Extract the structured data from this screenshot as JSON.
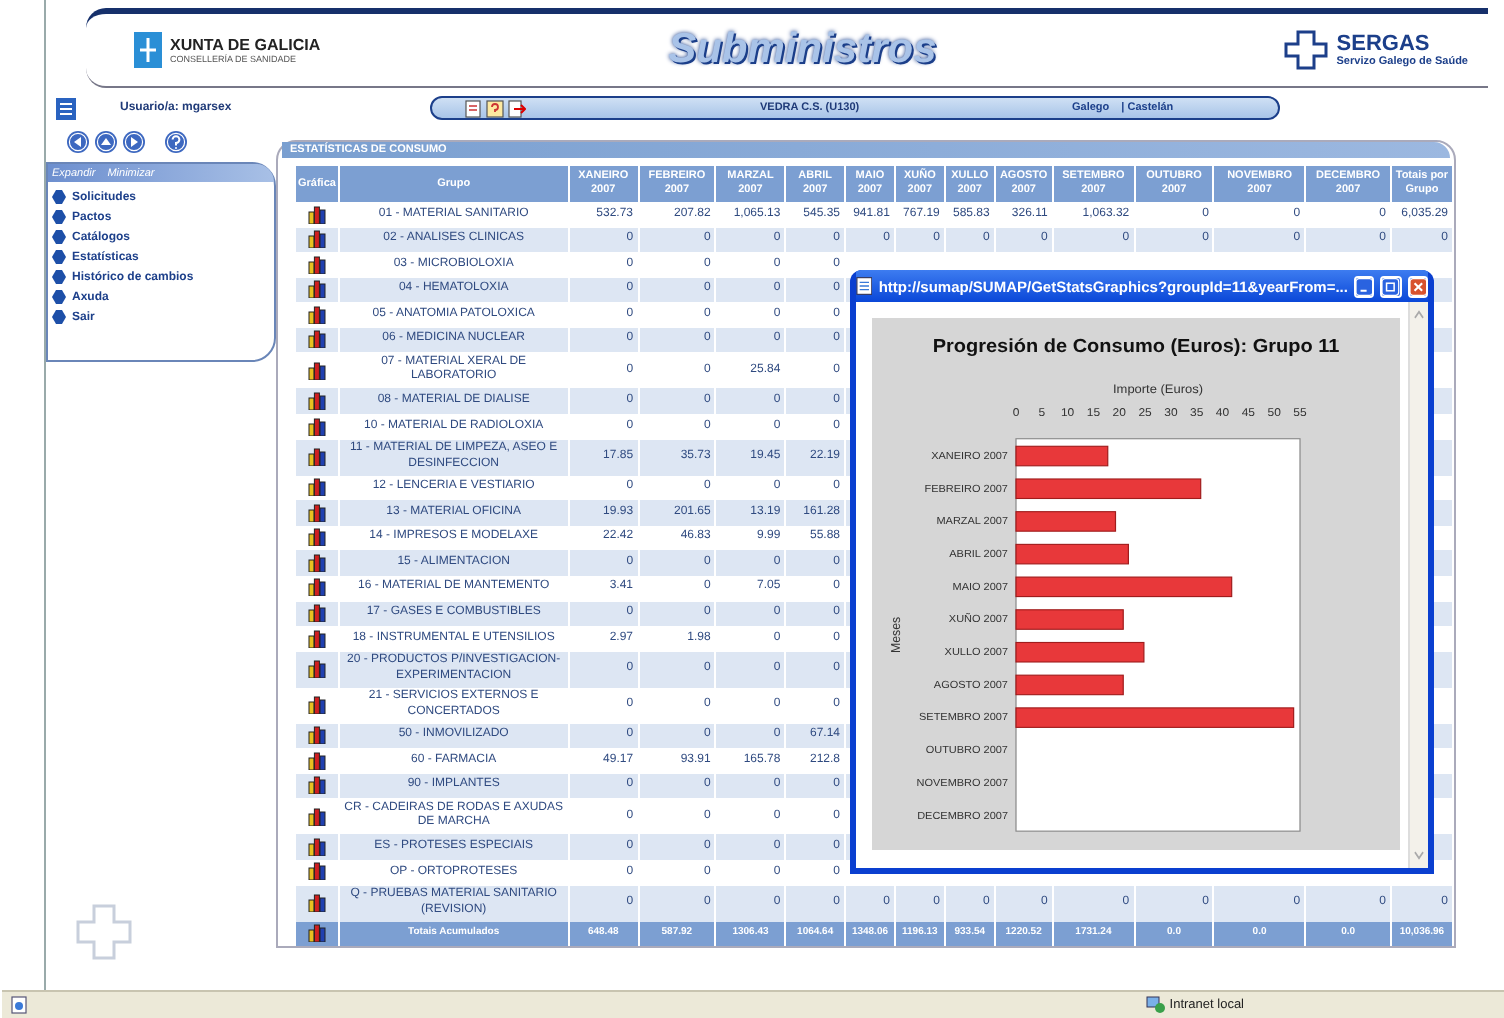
{
  "header": {
    "org": "XUNTA DE GALICIA",
    "org_sub": "CONSELLERÍA DE SANIDADE",
    "app_title": "Subministros",
    "brand": "SERGAS",
    "brand_sub": "Servizo Galego de Saúde"
  },
  "user_bar": {
    "user": "Usuario/a: mgarsex",
    "centre": "VEDRA C.S. (U130)",
    "languages": [
      "Galego",
      "| Castelán"
    ]
  },
  "sidebar": {
    "actions": [
      "Expandir",
      "Minimizar"
    ],
    "items": [
      "Solicitudes",
      "Pactos",
      "Catálogos",
      "Estatísticas",
      "Histórico de cambios",
      "Axuda",
      "Sair"
    ]
  },
  "section_title": "ESTATÍSTICAS DE CONSUMO",
  "table": {
    "columns": [
      {
        "label": "Gráfica"
      },
      {
        "label": "Grupo"
      },
      {
        "label": "XANEIRO",
        "sub": "2007"
      },
      {
        "label": "FEBREIRO",
        "sub": "2007"
      },
      {
        "label": "MARZAL",
        "sub": "2007"
      },
      {
        "label": "ABRIL",
        "sub": "2007"
      },
      {
        "label": "MAIO",
        "sub": "2007"
      },
      {
        "label": "XUÑO",
        "sub": "2007"
      },
      {
        "label": "XULLO",
        "sub": "2007"
      },
      {
        "label": "AGOSTO",
        "sub": "2007"
      },
      {
        "label": "SETEMBRO",
        "sub": "2007"
      },
      {
        "label": "OUTUBRO",
        "sub": "2007"
      },
      {
        "label": "NOVEMBRO",
        "sub": "2007"
      },
      {
        "label": "DECEMBRO",
        "sub": "2007"
      },
      {
        "label": "Totais por",
        "sub": "Grupo"
      }
    ],
    "rows": [
      {
        "group": "01 - MATERIAL SANITARIO",
        "values": [
          "532.73",
          "207.82",
          "1,065.13",
          "545.35",
          "941.81",
          "767.19",
          "585.83",
          "326.11",
          "1,063.32",
          "0",
          "0",
          "0",
          "6,035.29"
        ]
      },
      {
        "group": "02 - ANALISES CLINICAS",
        "values": [
          "0",
          "0",
          "0",
          "0",
          "0",
          "0",
          "0",
          "0",
          "0",
          "0",
          "0",
          "0",
          "0"
        ]
      },
      {
        "group": "03 - MICROBIOLOXIA",
        "values": [
          "0",
          "0",
          "0",
          "0"
        ]
      },
      {
        "group": "04 - HEMATOLOXIA",
        "values": [
          "0",
          "0",
          "0",
          "0"
        ]
      },
      {
        "group": "05 - ANATOMIA PATOLOXICA",
        "values": [
          "0",
          "0",
          "0",
          "0"
        ]
      },
      {
        "group": "06 - MEDICINA NUCLEAR",
        "values": [
          "0",
          "0",
          "0",
          "0"
        ]
      },
      {
        "group": "07 - MATERIAL XERAL DE LABORATORIO",
        "values": [
          "0",
          "0",
          "25.84",
          "0"
        ]
      },
      {
        "group": "08 - MATERIAL DE DIALISE",
        "values": [
          "0",
          "0",
          "0",
          "0"
        ]
      },
      {
        "group": "10 - MATERIAL DE RADIOLOXIA",
        "values": [
          "0",
          "0",
          "0",
          "0"
        ]
      },
      {
        "group": "11 - MATERIAL DE LIMPEZA, ASEO E DESINFECCION",
        "values": [
          "17.85",
          "35.73",
          "19.45",
          "22.19"
        ]
      },
      {
        "group": "12 - LENCERIA E VESTIARIO",
        "values": [
          "0",
          "0",
          "0",
          "0"
        ]
      },
      {
        "group": "13 - MATERIAL OFICINA",
        "values": [
          "19.93",
          "201.65",
          "13.19",
          "161.28"
        ]
      },
      {
        "group": "14 - IMPRESOS E MODELAXE",
        "values": [
          "22.42",
          "46.83",
          "9.99",
          "55.88"
        ]
      },
      {
        "group": "15 - ALIMENTACION",
        "values": [
          "0",
          "0",
          "0",
          "0"
        ]
      },
      {
        "group": "16 - MATERIAL DE MANTEMENTO",
        "values": [
          "3.41",
          "0",
          "7.05",
          "0"
        ]
      },
      {
        "group": "17 - GASES E COMBUSTIBLES",
        "values": [
          "0",
          "0",
          "0",
          "0"
        ]
      },
      {
        "group": "18 - INSTRUMENTAL E UTENSILIOS",
        "values": [
          "2.97",
          "1.98",
          "0",
          "0"
        ]
      },
      {
        "group": "20 - PRODUCTOS P/INVESTIGACION-EXPERIMENTACION",
        "values": [
          "0",
          "0",
          "0",
          "0"
        ]
      },
      {
        "group": "21 - SERVICIOS EXTERNOS E CONCERTADOS",
        "values": [
          "0",
          "0",
          "0",
          "0"
        ]
      },
      {
        "group": "50 - INMOVILIZADO",
        "values": [
          "0",
          "0",
          "0",
          "67.14"
        ]
      },
      {
        "group": "60 - FARMACIA",
        "values": [
          "49.17",
          "93.91",
          "165.78",
          "212.8"
        ]
      },
      {
        "group": "90 - IMPLANTES",
        "values": [
          "0",
          "0",
          "0",
          "0"
        ]
      },
      {
        "group": "CR - CADEIRAS DE RODAS E AXUDAS DE MARCHA",
        "values": [
          "0",
          "0",
          "0",
          "0"
        ]
      },
      {
        "group": "ES - PROTESES ESPECIAIS",
        "values": [
          "0",
          "0",
          "0",
          "0"
        ]
      },
      {
        "group": "OP - ORTOPROTESES",
        "values": [
          "0",
          "0",
          "0",
          "0"
        ]
      },
      {
        "group": "Q - PRUEBAS MATERIAL SANITARIO (REVISION)",
        "values": [
          "0",
          "0",
          "0",
          "0",
          "0",
          "0",
          "0",
          "0",
          "0",
          "0",
          "0",
          "0",
          "0"
        ]
      }
    ],
    "totals": {
      "label": "Totais Acumulados",
      "values": [
        "648.48",
        "587.92",
        "1306.43",
        "1064.64",
        "1348.06",
        "1196.13",
        "933.54",
        "1220.52",
        "1731.24",
        "0.0",
        "0.0",
        "0.0",
        "10,036.96"
      ]
    }
  },
  "popup": {
    "title": "http://sumap/SUMAP/GetStatsGraphics?groupId=11&yearFrom=...",
    "chart_data": {
      "type": "bar",
      "orientation": "horizontal",
      "title": "Progresión de Consumo (Euros): Grupo 11",
      "xlabel": "Importe (Euros)",
      "ylabel": "Meses",
      "categories": [
        "XANEIRO 2007",
        "FEBREIRO 2007",
        "MARZAL 2007",
        "ABRIL 2007",
        "MAIO 2007",
        "XUÑO 2007",
        "XULLO 2007",
        "AGOSTO 2007",
        "SETEMBRO 2007",
        "OUTUBRO 2007",
        "NOVEMBRO 2007",
        "DECEMBRO 2007"
      ],
      "series": [
        {
          "color": "#e8383a",
          "values": [
            18,
            36,
            19.5,
            22,
            42,
            21,
            25,
            21,
            54,
            0,
            0,
            0
          ]
        }
      ],
      "xlim": [
        0,
        55
      ],
      "xticks": [
        0,
        5,
        10,
        15,
        20,
        25,
        30,
        35,
        40,
        45,
        50,
        55
      ]
    }
  },
  "status_bar": {
    "zone": "Intranet local"
  }
}
